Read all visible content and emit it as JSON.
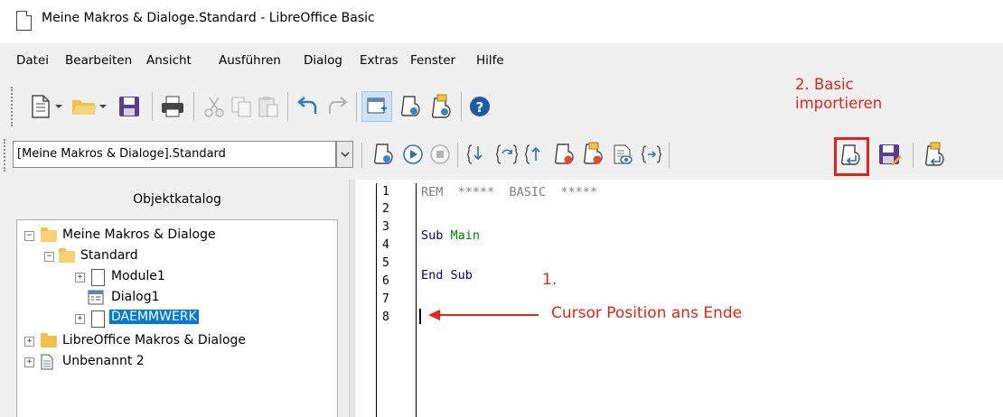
{
  "window": {
    "title": "Meine Makros & Dialoge.Standard - LibreOffice Basic"
  },
  "menu": {
    "items": [
      {
        "label": "Datei"
      },
      {
        "label": "Bearbeiten"
      },
      {
        "label": "Ansicht"
      },
      {
        "label": "Ausführen"
      },
      {
        "label": "Dialog"
      },
      {
        "label": "Extras"
      },
      {
        "label": "Fenster"
      },
      {
        "label": "Hilfe"
      }
    ]
  },
  "library_selector": {
    "value": "[Meine Makros & Dialoge].Standard"
  },
  "object_catalog": {
    "title": "Objektkatalog",
    "tree": [
      {
        "label": "Meine Makros & Dialoge",
        "expanded": true
      },
      {
        "label": "Standard",
        "expanded": true
      },
      {
        "label": "Module1"
      },
      {
        "label": "Dialog1"
      },
      {
        "label": "DAEMMWERK",
        "selected": true
      },
      {
        "label": "LibreOffice Makros & Dialoge"
      },
      {
        "label": "Unbenannt 2"
      }
    ]
  },
  "editor": {
    "line_numbers": [
      "1",
      "2",
      "3",
      "4",
      "5",
      "6",
      "7",
      "8"
    ],
    "code": {
      "line1": "REM  *****  BASIC  *****",
      "line3_keyword": "Sub",
      "line3_name": "Main",
      "line5": "End Sub"
    }
  },
  "annotations": {
    "step1": "1.",
    "cursor_hint": "Cursor Position ans Ende",
    "step2_line1": "2. Basic",
    "step2_line2": "importieren",
    "color": "#e0251b"
  },
  "icons": {
    "toolbar1": [
      "new-document-icon",
      "open-folder-icon",
      "save-icon",
      "print-icon",
      "cut-icon",
      "copy-icon",
      "paste-icon",
      "undo-icon",
      "redo-icon",
      "insert-controls-icon",
      "manage-macros-icon",
      "manage-dialogs-icon",
      "help-icon"
    ],
    "toolbar2": [
      "compile-icon",
      "run-icon",
      "stop-icon",
      "step-into-icon",
      "step-over-icon",
      "step-out-icon",
      "breakpoint-icon",
      "manage-breakpoints-icon",
      "watch-icon",
      "find-parentheses-icon",
      "import-basic-icon",
      "export-basic-icon",
      "import-dialog-icon"
    ]
  }
}
